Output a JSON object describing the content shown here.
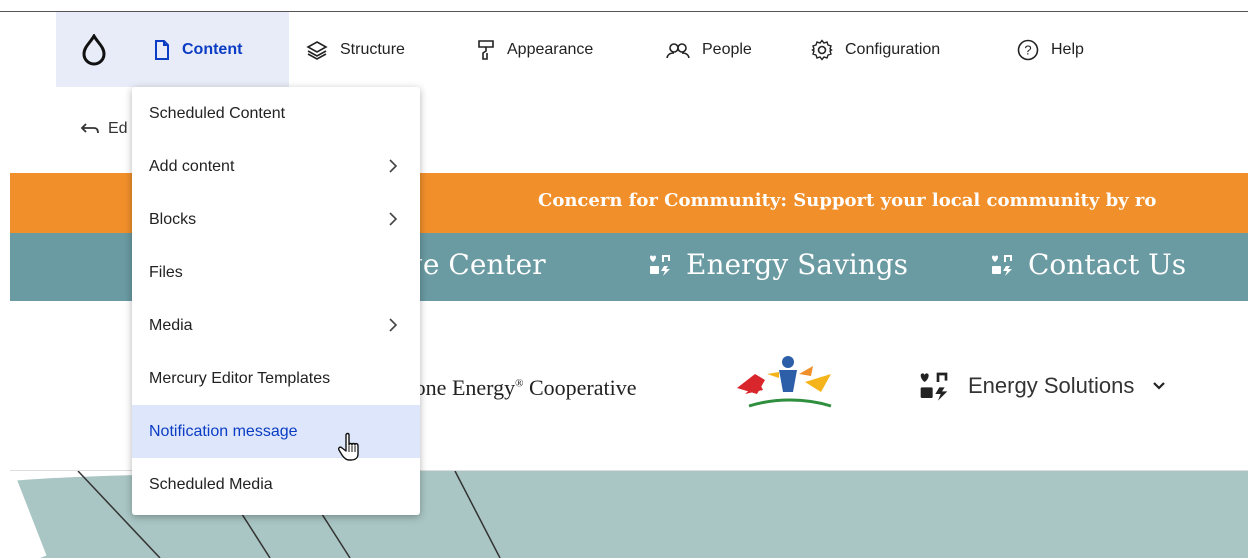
{
  "toolbar": {
    "items": [
      {
        "label": "Content",
        "icon": "file-icon",
        "active": true
      },
      {
        "label": "Structure",
        "icon": "layers-icon"
      },
      {
        "label": "Appearance",
        "icon": "paint-roller-icon"
      },
      {
        "label": "People",
        "icon": "people-icon"
      },
      {
        "label": "Configuration",
        "icon": "gear-icon"
      },
      {
        "label": "Help",
        "icon": "help-circle-icon"
      }
    ],
    "accent": "#0b3dc4",
    "active_bg": "#e8ecf8"
  },
  "secondary": {
    "back_label": "Ed"
  },
  "dropdown": {
    "items": [
      {
        "label": "Scheduled Content",
        "submenu": false
      },
      {
        "label": "Add content",
        "submenu": true
      },
      {
        "label": "Blocks",
        "submenu": true
      },
      {
        "label": "Files",
        "submenu": false
      },
      {
        "label": "Media",
        "submenu": true
      },
      {
        "label": "Mercury Editor Templates",
        "submenu": false
      },
      {
        "label": "Notification message",
        "submenu": false,
        "highlighted": true
      },
      {
        "label": "Scheduled Media",
        "submenu": false
      }
    ]
  },
  "site": {
    "banner_text": "Concern for Community:  Support your local community by ro",
    "banner_color": "#f18f2b",
    "nav_color": "#6a9aa2",
    "nav_links": [
      {
        "label": "ge Center"
      },
      {
        "label": "Energy Savings",
        "icon": "activities-icon"
      },
      {
        "label": "Contact Us",
        "icon": "activities-icon"
      }
    ],
    "brand_name": "stone Energy",
    "brand_reg": "®",
    "brand_suffix": " Cooperative",
    "solutions_label": "Energy Solutions"
  }
}
